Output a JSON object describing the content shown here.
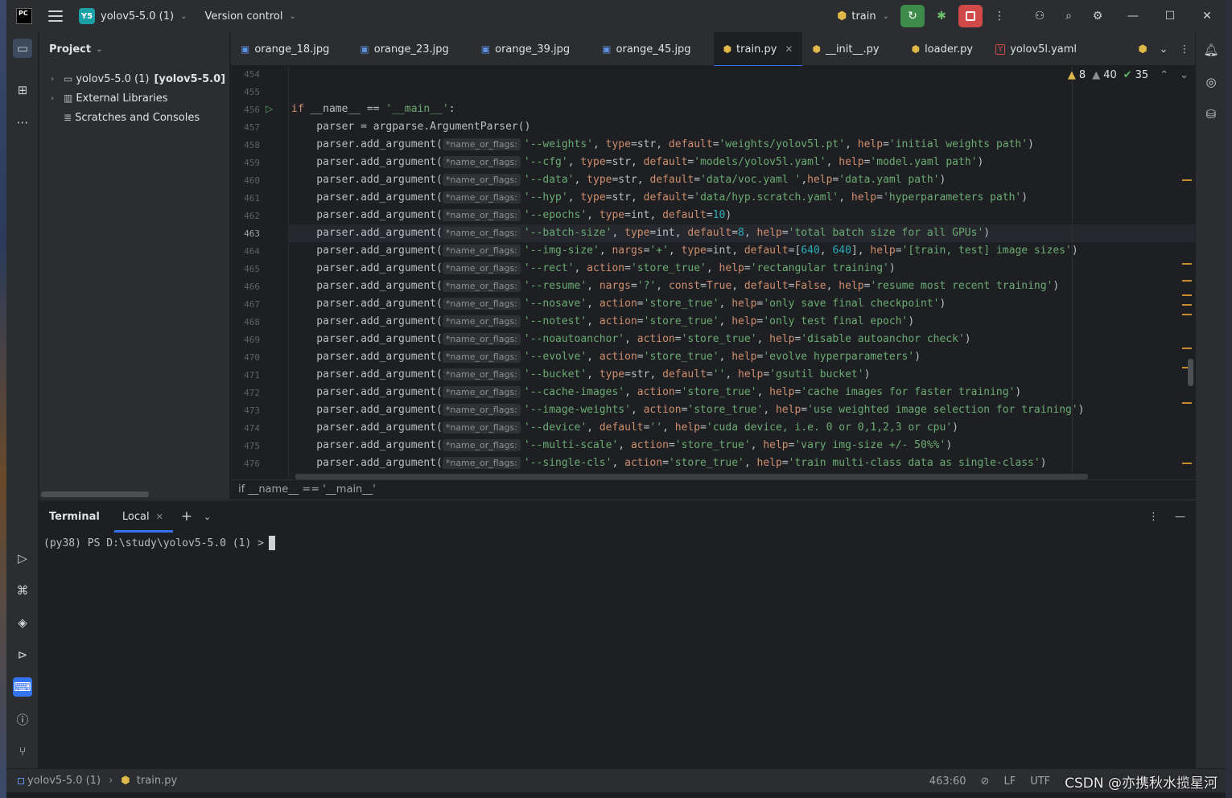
{
  "titlebar": {
    "logo": "PC",
    "project_badge": "Y5",
    "project_name": "yolov5-5.0 (1)",
    "vcs": "Version control",
    "run_config": "train"
  },
  "project_panel": {
    "title": "Project",
    "items": [
      {
        "label": "yolov5-5.0 (1)",
        "extra": "[yolov5-5.0]"
      },
      {
        "label": "External Libraries",
        "extra": ""
      },
      {
        "label": "Scratches and Consoles",
        "extra": ""
      }
    ]
  },
  "tabs": [
    {
      "label": "orange_18.jpg",
      "type": "img"
    },
    {
      "label": "orange_23.jpg",
      "type": "img"
    },
    {
      "label": "orange_39.jpg",
      "type": "img"
    },
    {
      "label": "orange_45.jpg",
      "type": "img"
    },
    {
      "label": "train.py",
      "type": "py",
      "active": true
    },
    {
      "label": "__init__.py",
      "type": "py"
    },
    {
      "label": "loader.py",
      "type": "py"
    },
    {
      "label": "yolov5l.yaml",
      "type": "yml"
    }
  ],
  "inspections": {
    "warnings": "8",
    "weak": "40",
    "ok": "35"
  },
  "hint_label": "*name_or_flags:",
  "line_numbers": [
    "454",
    "455",
    "456",
    "457",
    "458",
    "459",
    "460",
    "461",
    "462",
    "463",
    "464",
    "465",
    "466",
    "467",
    "468",
    "469",
    "470",
    "471",
    "472",
    "473",
    "474",
    "475",
    "476"
  ],
  "current_line": "463",
  "code": {
    "l456": "if __name__ == '__main__':",
    "l457": "    parser = argparse.ArgumentParser()",
    "call": "    parser.add_argument(",
    "args": [
      "'--weights', type=str, default='weights/yolov5l.pt', help='initial weights path')",
      "'--cfg', type=str, default='models/yolov5l.yaml', help='model.yaml path')",
      "'--data', type=str, default='data/voc.yaml ',help='data.yaml path')",
      "'--hyp', type=str, default='data/hyp.scratch.yaml', help='hyperparameters path')",
      "'--epochs', type=int, default=10)",
      "'--batch-size', type=int, default=8, help='total batch size for all GPUs')",
      "'--img-size', nargs='+', type=int, default=[640, 640], help='[train, test] image sizes')",
      "'--rect', action='store_true', help='rectangular training')",
      "'--resume', nargs='?', const=True, default=False, help='resume most recent training')",
      "'--nosave', action='store_true', help='only save final checkpoint')",
      "'--notest', action='store_true', help='only test final epoch')",
      "'--noautoanchor', action='store_true', help='disable autoanchor check')",
      "'--evolve', action='store_true', help='evolve hyperparameters')",
      "'--bucket', type=str, default='', help='gsutil bucket')",
      "'--cache-images', action='store_true', help='cache images for faster training')",
      "'--image-weights', action='store_true', help='use weighted image selection for training')",
      "'--device', default='', help='cuda device, i.e. 0 or 0,1,2,3 or cpu')",
      "'--multi-scale', action='store_true', help='vary img-size +/- 50%%')",
      "'--single-cls', action='store_true', help='train multi-class data as single-class')"
    ]
  },
  "breadcrumb": "if __name__ == '__main__'",
  "terminal": {
    "title": "Terminal",
    "tab": "Local",
    "prompt": "(py38) PS D:\\study\\yolov5-5.0 (1) >"
  },
  "status": {
    "project": "yolov5-5.0 (1)",
    "file": "train.py",
    "position": "463:60",
    "line_sep": "LF",
    "encoding": "UTF",
    "watermark": "CSDN @亦携秋水揽星河"
  },
  "colors": {
    "accent": "#3574f0",
    "string": "#6aab73",
    "keyword": "#cf8e6d",
    "number": "#2aacb8"
  }
}
